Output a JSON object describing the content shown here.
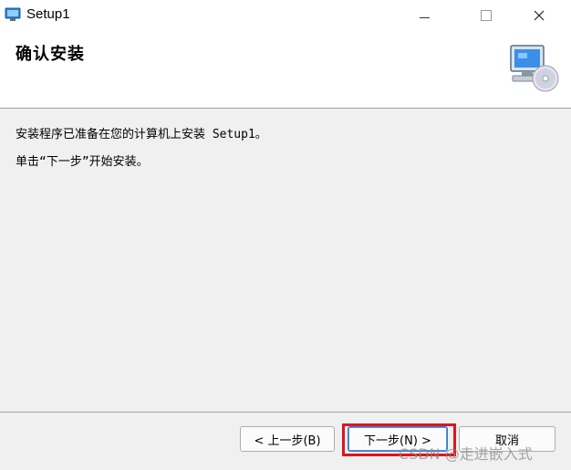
{
  "window": {
    "title": "Setup1",
    "app_icon": "setup-installer-icon",
    "controls": {
      "minimize": "minimize-icon",
      "maximize": "maximize-icon",
      "close": "close-icon"
    }
  },
  "header": {
    "title": "确认安装",
    "icon": "computer-cd-icon"
  },
  "body": {
    "line1": "安装程序已准备在您的计算机上安装 Setup1。",
    "line2": "单击“下一步”开始安装。"
  },
  "buttons": {
    "back_label": "< 上一步(B)",
    "next_label": "下一步(N) >",
    "cancel_label": "取消"
  },
  "watermark": "CSDN @走进嵌入式",
  "colors": {
    "highlight": "#e0141c",
    "accent_border": "#3a77c9"
  }
}
